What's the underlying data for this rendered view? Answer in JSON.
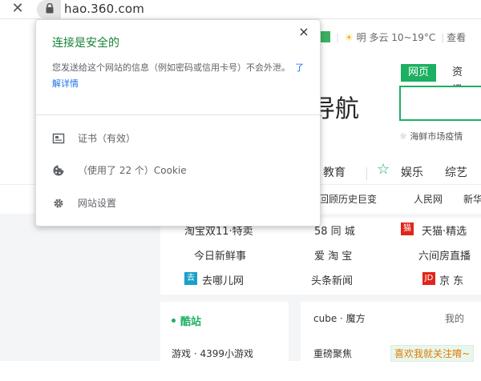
{
  "browser": {
    "url": "hao.360.com"
  },
  "background_page": {
    "weather_text": "明 多云 10~19°C",
    "weather_extra": "查看",
    "search_tab_active": "网页",
    "search_tab_next": "资讯",
    "title_fragment": "导航",
    "hot_search": "海鲜市场疫情",
    "categories": [
      "教育",
      "娱乐",
      "综艺"
    ],
    "news": [
      "回顾历史巨变",
      "人民网",
      "新华"
    ],
    "sites": [
      {
        "label": "淘宝双11·特卖",
        "icon": ""
      },
      {
        "label": "58 同 城",
        "icon": ""
      },
      {
        "label": "天猫·精选",
        "icon": "天猫",
        "icon_color": "#e1251b"
      },
      {
        "label": "今日新鲜事",
        "icon": ""
      },
      {
        "label": "爱 淘 宝",
        "icon": ""
      },
      {
        "label": "六间房直播",
        "icon": ""
      },
      {
        "label": "去哪儿网",
        "icon": "去",
        "icon_color": "#19a0c8"
      },
      {
        "label": "头条新闻",
        "icon": ""
      },
      {
        "label": "京 东",
        "icon": "JD",
        "icon_color": "#e1251b"
      }
    ],
    "panel_left": {
      "title": "酷站",
      "line": "游戏 · 4399小游戏"
    },
    "panel_right": {
      "line1_a": "cube · 魔方",
      "line1_b": "我的",
      "line2_a": "重磅聚焦",
      "line2_b": "喜欢我就关注唷~"
    }
  },
  "popup": {
    "close_symbol": "×",
    "heading": "连接是安全的",
    "description": "您发送给这个网站的信息（例如密码或信用卡号）不会外泄。",
    "learn_more": "了解详情",
    "items": [
      {
        "label": "证书（有效）",
        "icon": "certificate-icon"
      },
      {
        "label": "（使用了 22 个）Cookie",
        "icon": "cookie-icon"
      },
      {
        "label": "网站设置",
        "icon": "gear-icon"
      }
    ]
  },
  "colors": {
    "secure_green": "#188038",
    "brand_green": "#1cb062",
    "link_blue": "#1a73e8"
  }
}
